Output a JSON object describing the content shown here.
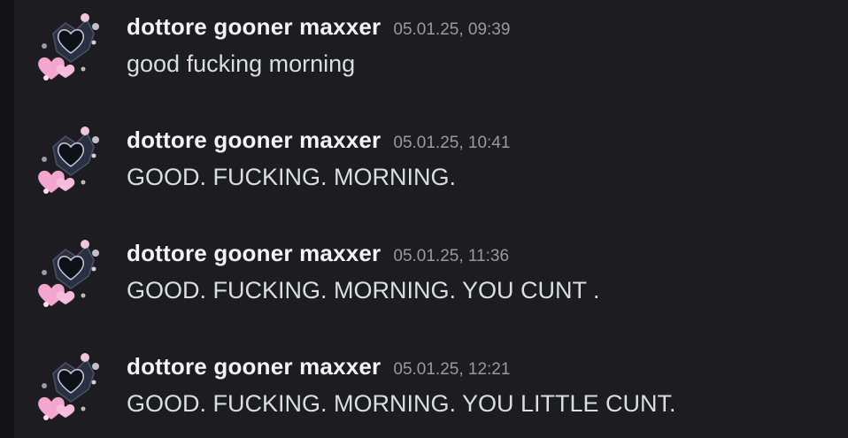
{
  "messages": [
    {
      "author": "dottore gooner maxxer",
      "timestamp": "05.01.25, 09:39",
      "content": "good fucking morning",
      "avatar_icon": "heart-collage-avatar-icon"
    },
    {
      "author": "dottore gooner maxxer",
      "timestamp": "05.01.25, 10:41",
      "content": "GOOD. FUCKING. MORNING.",
      "avatar_icon": "heart-collage-avatar-icon"
    },
    {
      "author": "dottore gooner maxxer",
      "timestamp": "05.01.25, 11:36",
      "content": "GOOD. FUCKING. MORNING. YOU CUNT .",
      "avatar_icon": "heart-collage-avatar-icon"
    },
    {
      "author": "dottore gooner maxxer",
      "timestamp": "05.01.25, 12:21",
      "content": "GOOD. FUCKING. MORNING. YOU LITTLE CUNT.",
      "avatar_icon": "heart-collage-avatar-icon"
    }
  ],
  "colors": {
    "background": "#1c1c21",
    "username": "#f2f3f5",
    "timestamp": "#949ba4",
    "message_text": "#dbdee1",
    "avatar_heart_pink": "#f4a6cf",
    "avatar_dark": "#2b3040"
  }
}
